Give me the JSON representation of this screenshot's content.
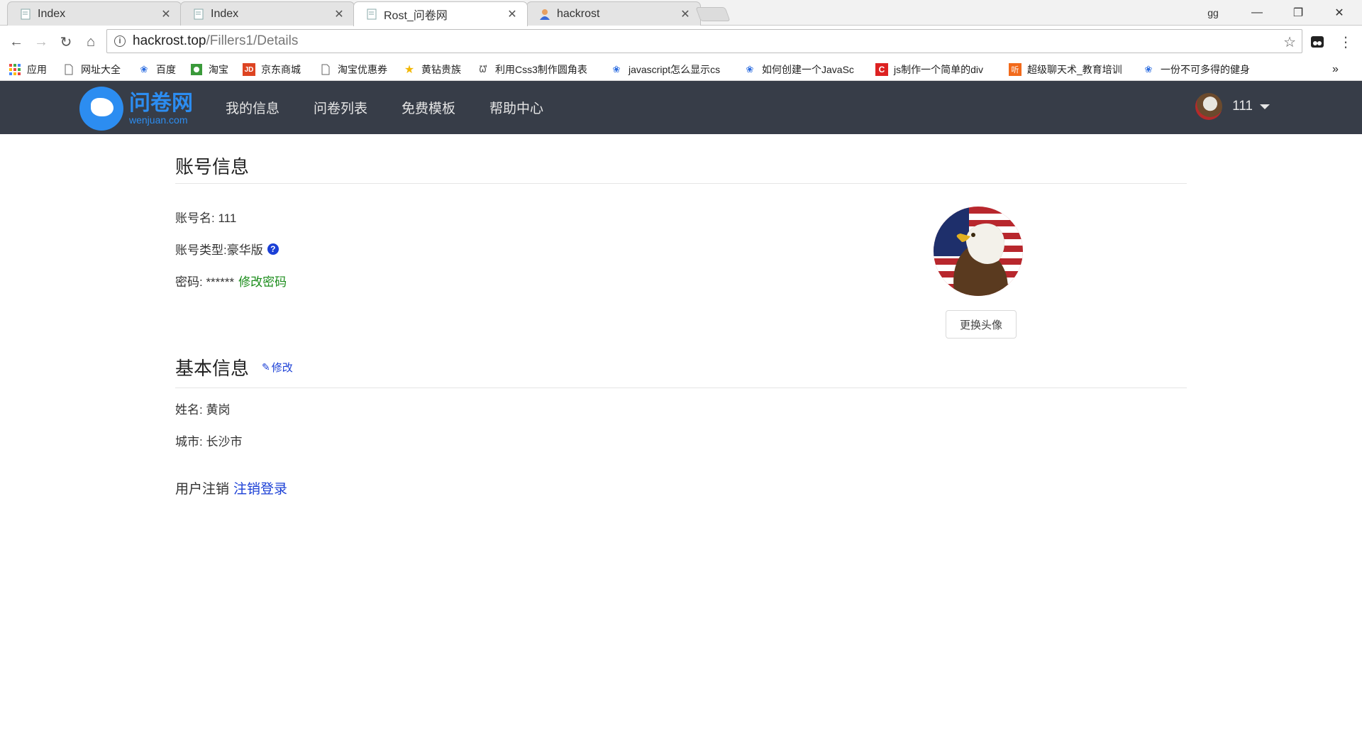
{
  "browser": {
    "tabs": [
      {
        "title": "Index"
      },
      {
        "title": "Index"
      },
      {
        "title": "Rost_问卷网"
      },
      {
        "title": "hackrost"
      }
    ],
    "profile_label": "gg",
    "url_host": "hackrost.top",
    "url_path": "/Fillers1/Details",
    "bookmarks": [
      {
        "label": "应用",
        "icon": "apps-grid-icon"
      },
      {
        "label": "网址大全",
        "icon": "page-icon"
      },
      {
        "label": "百度",
        "icon": "baidu-paw-icon"
      },
      {
        "label": "淘宝",
        "icon": "taobao-icon"
      },
      {
        "label": "京东商城",
        "icon": "jd-icon"
      },
      {
        "label": "淘宝优惠券",
        "icon": "page-icon"
      },
      {
        "label": "黄钻贵族",
        "icon": "star-icon"
      },
      {
        "label": "利用Css3制作圆角表",
        "icon": "w3-icon"
      },
      {
        "label": "javascript怎么显示cs",
        "icon": "baidu-paw-icon"
      },
      {
        "label": "如何创建一个JavaSc",
        "icon": "baidu-paw-icon"
      },
      {
        "label": "js制作一个简单的div",
        "icon": "csdn-icon"
      },
      {
        "label": "超级聊天术_教育培训",
        "icon": "ting-icon"
      },
      {
        "label": "一份不可多得的健身",
        "icon": "baidu-paw-icon"
      }
    ],
    "overflow": "»"
  },
  "site": {
    "logo_cn": "问卷网",
    "logo_en": "wenjuan.com",
    "nav": [
      "我的信息",
      "问卷列表",
      "免费模板",
      "帮助中心"
    ],
    "user_name": "111"
  },
  "account": {
    "title": "账号信息",
    "username_label": "账号名: 111",
    "type_label": "账号类型:豪华版",
    "password_label": "密码: ******",
    "change_password": "修改密码",
    "change_avatar": "更换头像"
  },
  "basic": {
    "title": "基本信息",
    "edit": "修改",
    "name_label": "姓名: 黄岗",
    "city_label": "城市: 长沙市"
  },
  "logout": {
    "label": "用户注销",
    "link": "注销登录"
  }
}
